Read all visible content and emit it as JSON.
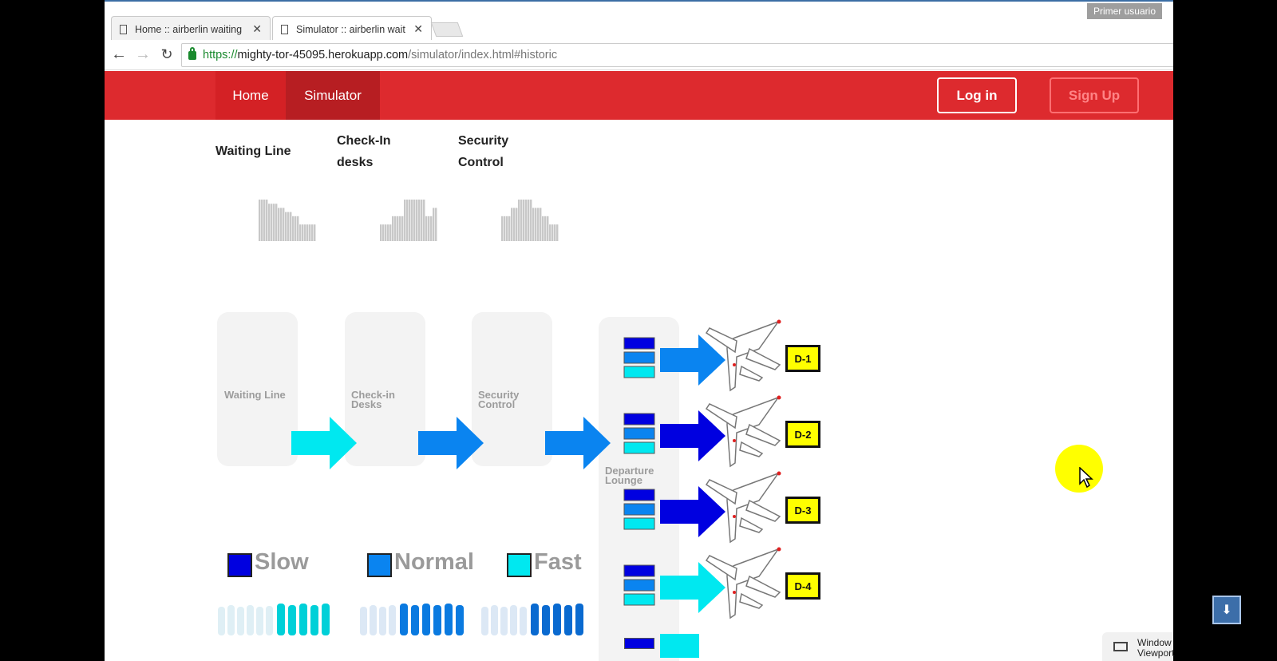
{
  "browser": {
    "tabs": [
      {
        "title": "Home :: airberlin waiting",
        "active": false
      },
      {
        "title": "Simulator :: airberlin wait",
        "active": true
      }
    ],
    "profile_label": "Primer usuario",
    "url": {
      "scheme": "https://",
      "host": "mighty-tor-45095.herokuapp.com",
      "path": "/simulator/index.html#historic"
    }
  },
  "navbar": {
    "brand_color": "#dd2a2e",
    "links": {
      "home": "Home",
      "simulator": "Simulator"
    },
    "login": "Log in",
    "signup": "Sign Up"
  },
  "headers": {
    "waiting_line": "Waiting Line",
    "checkin": "Check-In desks",
    "security": "Security Control"
  },
  "histograms": [
    {
      "name": "waiting-line",
      "values": [
        10,
        10,
        10,
        10,
        9,
        9,
        9,
        9,
        8,
        8,
        8,
        7,
        7,
        7,
        6,
        6,
        6,
        4,
        4,
        4,
        4,
        4,
        4,
        4
      ]
    },
    {
      "name": "check-in",
      "values": [
        4,
        4,
        4,
        4,
        4,
        6,
        6,
        6,
        6,
        6,
        10,
        10,
        10,
        10,
        10,
        10,
        10,
        10,
        10,
        6,
        6,
        6,
        8,
        8
      ]
    },
    {
      "name": "security",
      "values": [
        6,
        6,
        6,
        6,
        8,
        8,
        8,
        10,
        10,
        10,
        10,
        10,
        10,
        8,
        8,
        8,
        8,
        6,
        6,
        6,
        4,
        4,
        4,
        4
      ]
    }
  ],
  "process": {
    "stages": {
      "waiting_line": "Waiting Line",
      "checkin": "Check-in Desks",
      "security": "Security Control",
      "lounge": "Departure Lounge"
    },
    "flow_speeds": [
      "Fast",
      "Normal",
      "Normal"
    ]
  },
  "legend": {
    "slow": {
      "label": "Slow",
      "color": "#0000e0"
    },
    "normal": {
      "label": "Normal",
      "color": "#0a84f0"
    },
    "fast": {
      "label": "Fast",
      "color": "#00e8f0"
    }
  },
  "gates": [
    {
      "label": "D-1",
      "speed": "Normal",
      "bars": [
        "Slow",
        "Normal",
        "Fast"
      ]
    },
    {
      "label": "D-2",
      "speed": "Slow",
      "bars": [
        "Slow",
        "Normal",
        "Fast"
      ]
    },
    {
      "label": "D-3",
      "speed": "Slow",
      "bars": [
        "Slow",
        "Normal",
        "Fast"
      ]
    },
    {
      "label": "D-4",
      "speed": "Fast",
      "bars": [
        "Slow",
        "Normal",
        "Fast"
      ]
    }
  ],
  "overlay": {
    "window_badge": "Window Viewport"
  }
}
